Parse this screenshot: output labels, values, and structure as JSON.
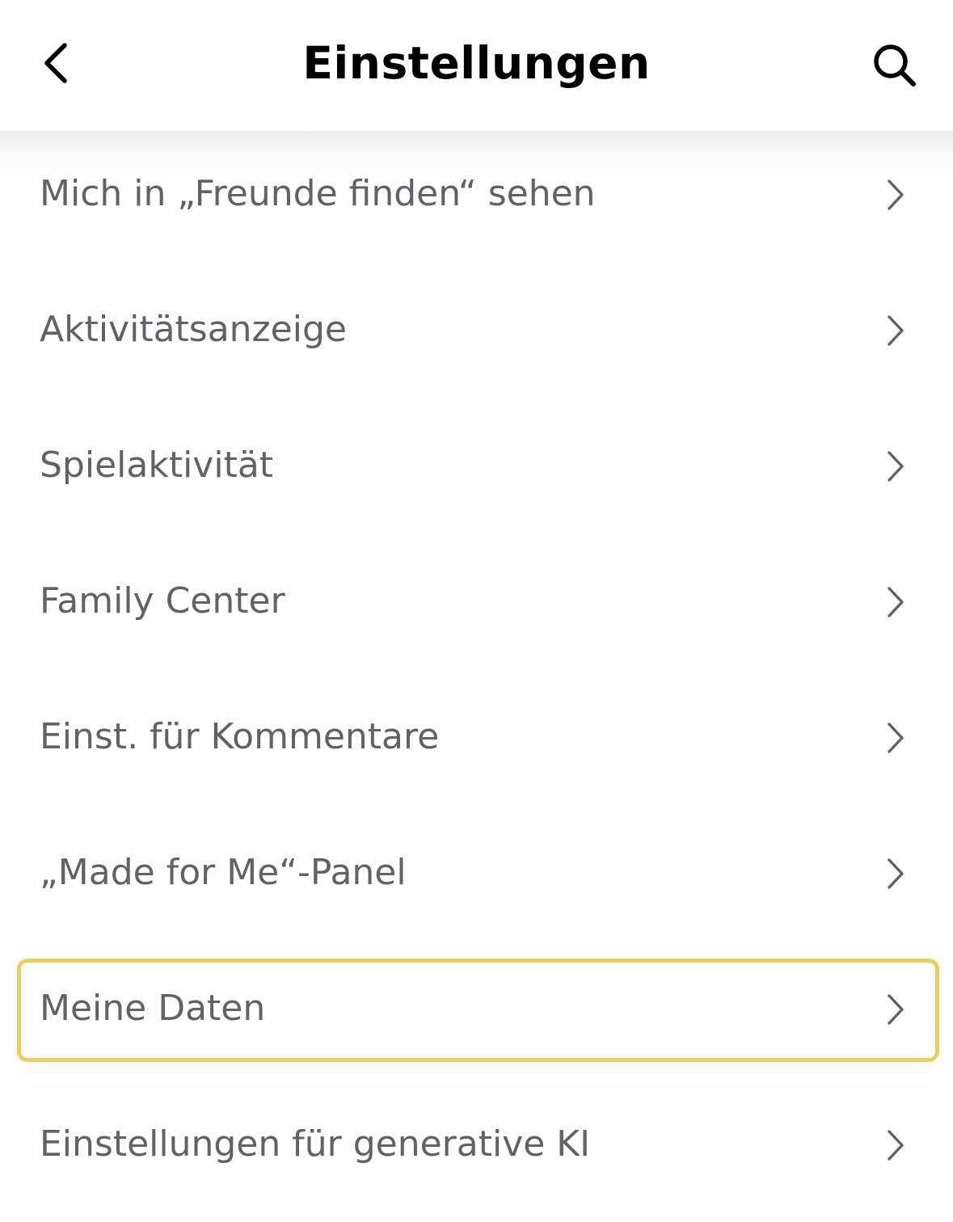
{
  "header": {
    "title": "Einstellungen",
    "back_icon": "chevron-left-icon",
    "search_icon": "search-icon"
  },
  "settings": {
    "items": [
      {
        "label": "Mich in „Freunde finden“ sehen",
        "icon": "chevron-right-icon",
        "highlighted": false
      },
      {
        "label": "Aktivitätsanzeige",
        "icon": "chevron-right-icon",
        "highlighted": false
      },
      {
        "label": "Spielaktivität",
        "icon": "chevron-right-icon",
        "highlighted": false
      },
      {
        "label": "Family Center",
        "icon": "chevron-right-icon",
        "highlighted": false
      },
      {
        "label": "Einst. für Kommentare",
        "icon": "chevron-right-icon",
        "highlighted": false
      },
      {
        "label": "„Made for Me“-Panel",
        "icon": "chevron-right-icon",
        "highlighted": false
      },
      {
        "label": "Meine Daten",
        "icon": "chevron-right-icon",
        "highlighted": true
      },
      {
        "label": "Einstellungen für generative KI",
        "icon": "chevron-right-icon",
        "highlighted": false
      }
    ]
  },
  "colors": {
    "title_text": "#000000",
    "item_text": "#5f6269",
    "chevron": "#5f6269",
    "highlight_border": "#ebcd60",
    "background": "#ffffff"
  }
}
